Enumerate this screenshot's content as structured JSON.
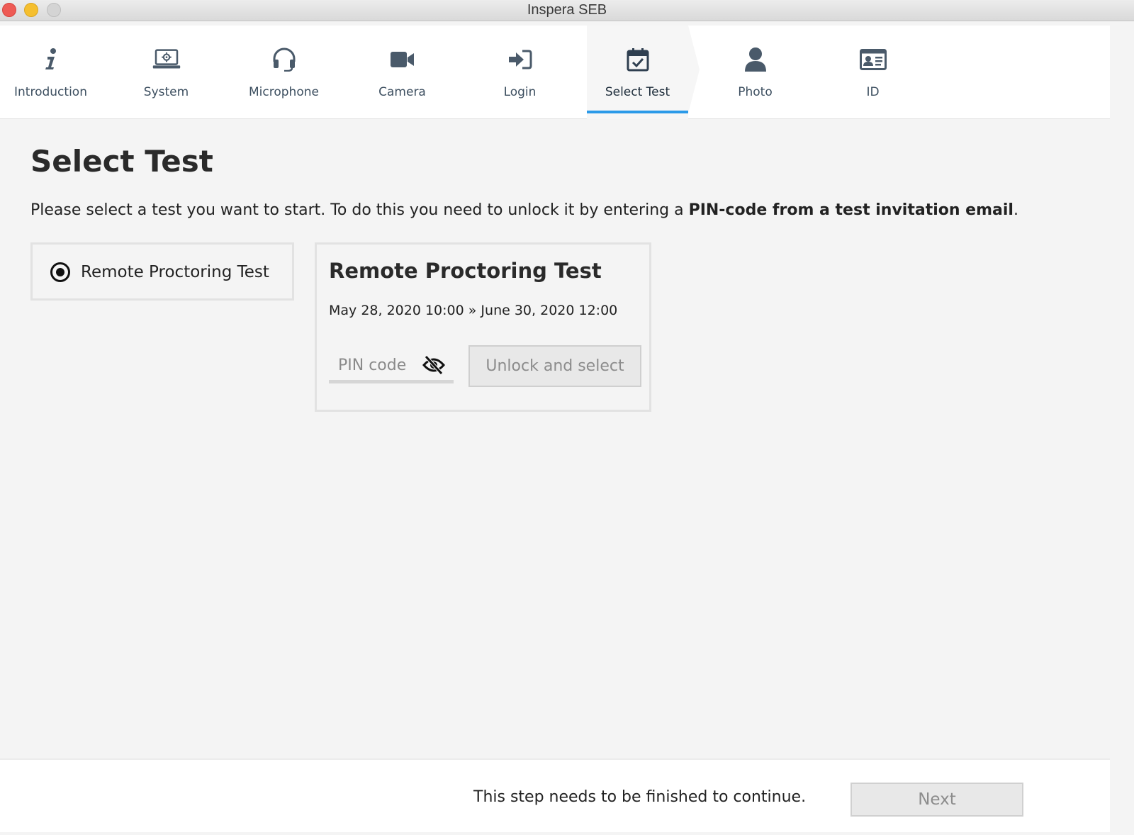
{
  "window": {
    "title": "Inspera SEB"
  },
  "steps": [
    {
      "label": "Introduction",
      "icon": "info-icon"
    },
    {
      "label": "System",
      "icon": "laptop-settings-icon"
    },
    {
      "label": "Microphone",
      "icon": "headset-icon"
    },
    {
      "label": "Camera",
      "icon": "video-camera-icon"
    },
    {
      "label": "Login",
      "icon": "sign-in-icon"
    },
    {
      "label": "Select Test",
      "icon": "calendar-check-icon",
      "active": true
    },
    {
      "label": "Photo",
      "icon": "user-icon"
    },
    {
      "label": "ID",
      "icon": "id-card-icon"
    }
  ],
  "main": {
    "title": "Select Test",
    "instructions_prefix": "Please select a test you want to start. To do this you need to unlock it by entering a ",
    "instructions_bold": "PIN-code from a test invitation email",
    "instructions_suffix": "."
  },
  "test_list": [
    {
      "name": "Remote Proctoring Test",
      "selected": true
    }
  ],
  "test_card": {
    "title": "Remote Proctoring Test",
    "dates": "May 28, 2020 10:00 » June 30, 2020 12:00",
    "pin_value": "",
    "pin_placeholder": "PIN code",
    "unlock_label": "Unlock and select"
  },
  "footer": {
    "message": "This step needs to be finished to continue.",
    "next_label": "Next"
  },
  "colors": {
    "accent": "#2b9ae8",
    "icon": "#4a5a6a"
  }
}
